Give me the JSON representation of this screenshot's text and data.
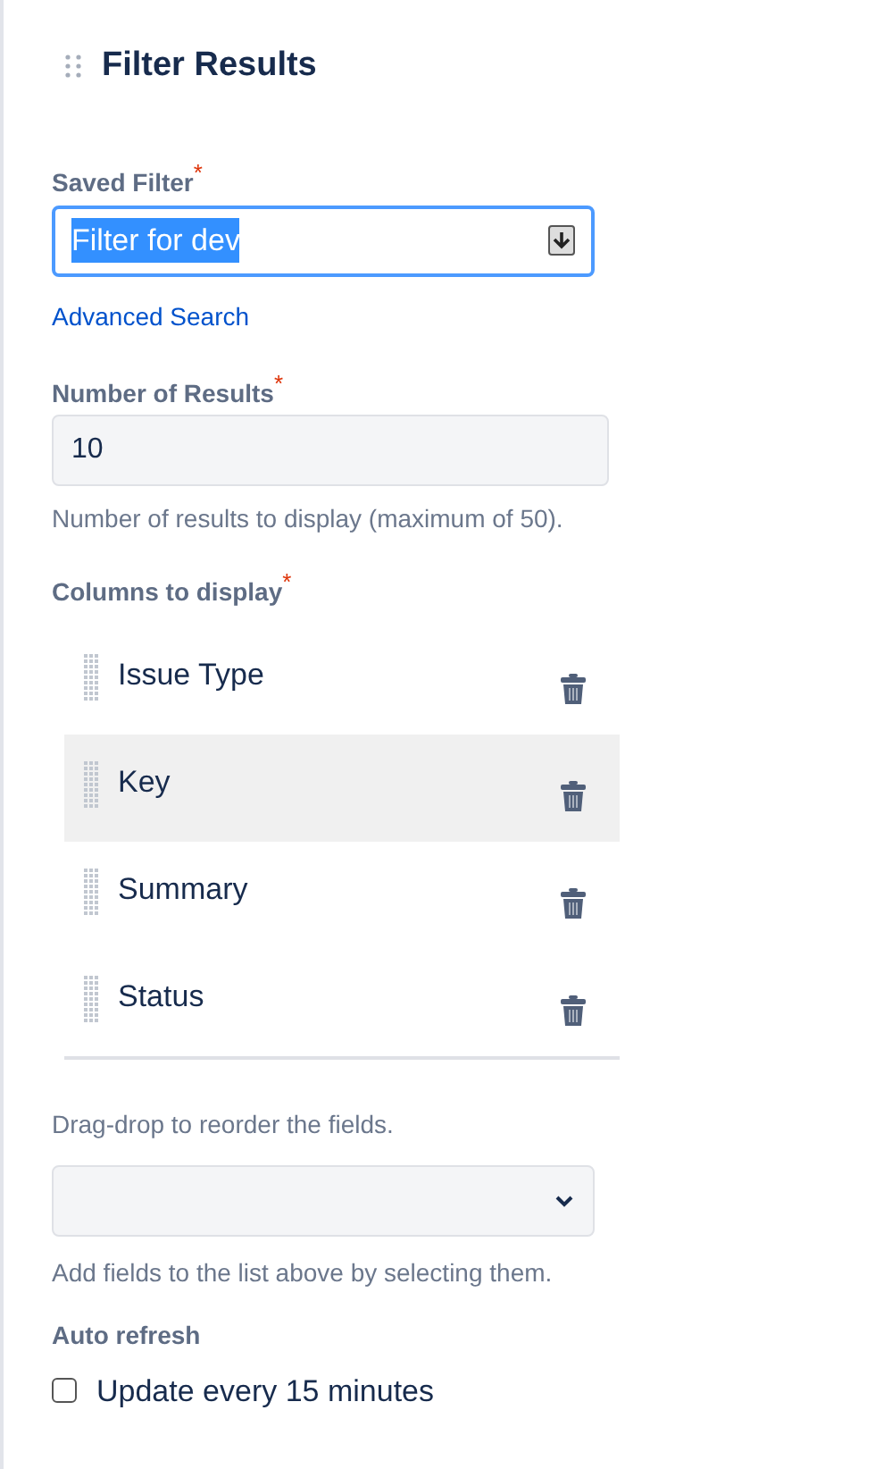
{
  "panel": {
    "title": "Filter Results"
  },
  "saved_filter": {
    "label": "Saved Filter",
    "required_mark": "*",
    "value": "Filter for dev",
    "text_selected": true,
    "focused": true
  },
  "advanced_search": "Advanced Search",
  "number_of_results": {
    "label": "Number of Results",
    "required_mark": "*",
    "value": "10",
    "help": "Number of results to display (maximum of 50)."
  },
  "columns": {
    "label": "Columns to display",
    "required_mark": "*",
    "items": [
      {
        "name": "Issue Type",
        "highlighted": false
      },
      {
        "name": "Key",
        "highlighted": true
      },
      {
        "name": "Summary",
        "highlighted": false
      },
      {
        "name": "Status",
        "highlighted": false
      }
    ],
    "help": "Drag-drop to reorder the fields."
  },
  "add_fields": {
    "help": "Add fields to the list above by selecting them."
  },
  "auto_refresh": {
    "label": "Auto refresh",
    "option": "Update every 15 minutes",
    "checked": false
  }
}
